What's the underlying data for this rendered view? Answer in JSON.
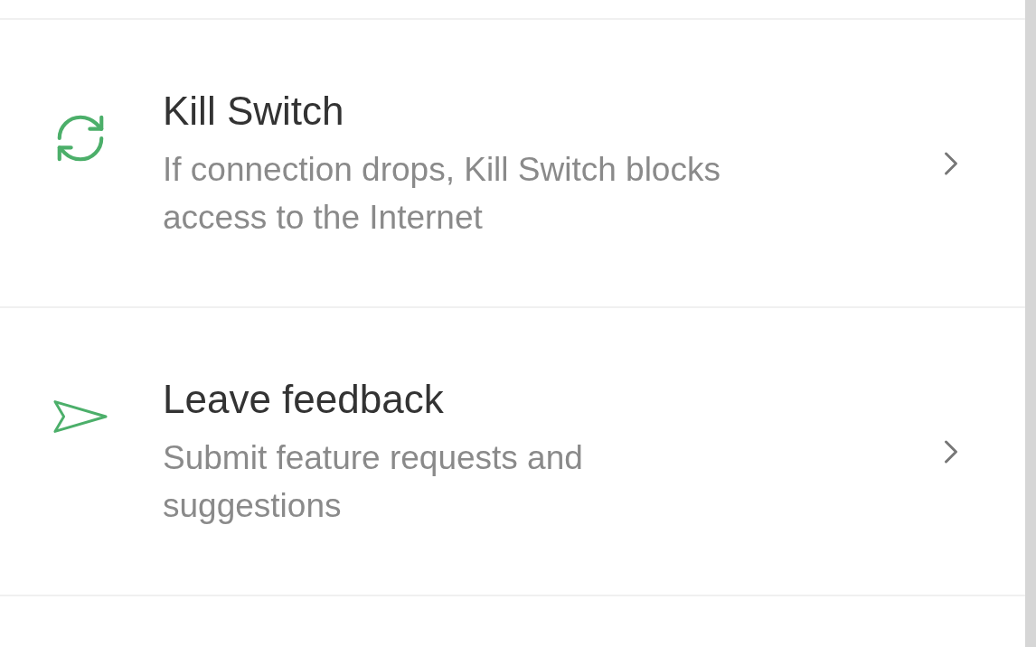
{
  "items": [
    {
      "kind": "refresh",
      "title": "Kill Switch",
      "description": "If connection drops, Kill Switch blocks access to the Internet"
    },
    {
      "kind": "send",
      "title": "Leave feedback",
      "description": "Submit feature requests and suggestions"
    }
  ]
}
